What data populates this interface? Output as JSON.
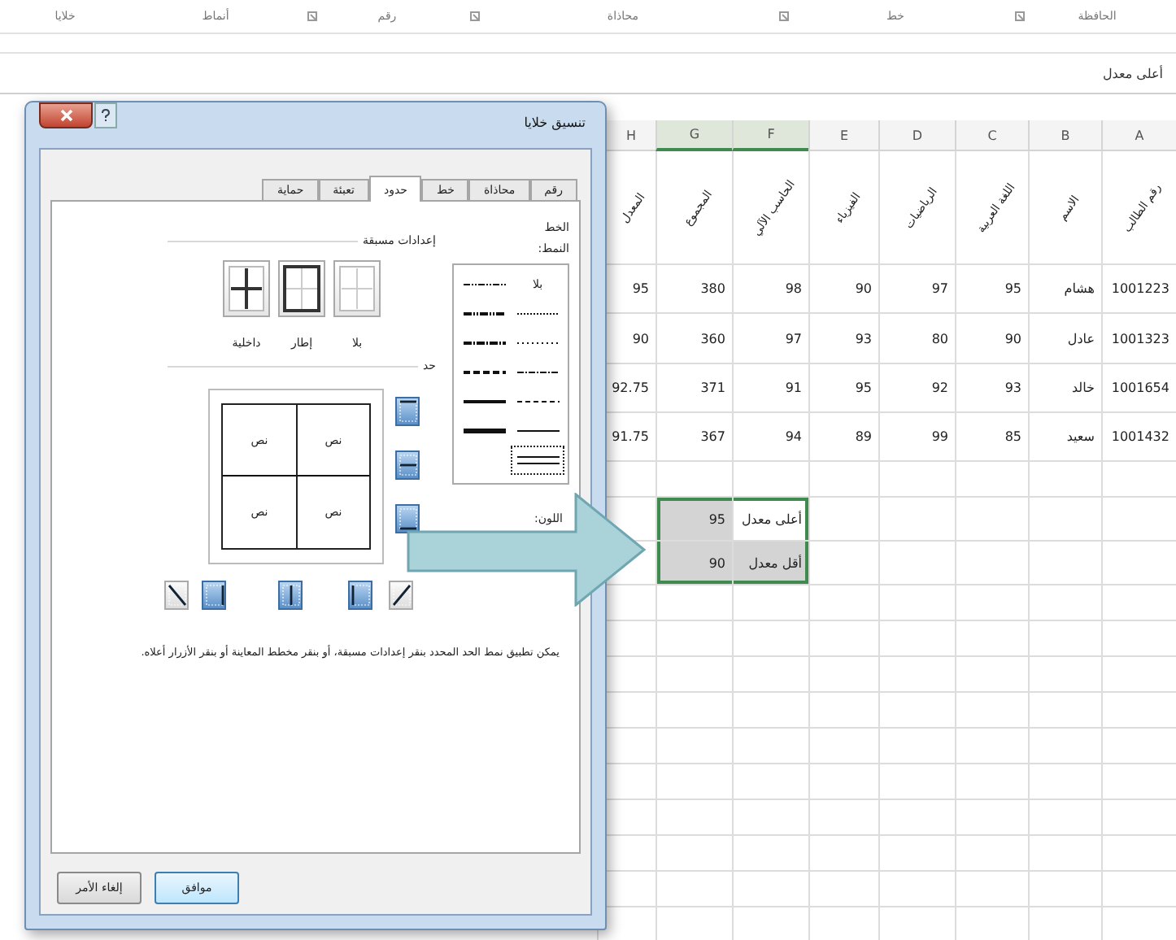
{
  "ribbon": {
    "groups": [
      {
        "label": "الحافظة",
        "launcher": true
      },
      {
        "label": "خط",
        "launcher": true
      },
      {
        "label": "محاذاة",
        "launcher": true
      },
      {
        "label": "رقم",
        "launcher": true
      },
      {
        "label": "أنماط",
        "launcher": false
      },
      {
        "label": "خلايا",
        "launcher": false
      }
    ]
  },
  "formula_bar": {
    "value": "أعلى معدل"
  },
  "sheet": {
    "columns": [
      {
        "label": "A",
        "selected": false
      },
      {
        "label": "B",
        "selected": false
      },
      {
        "label": "C",
        "selected": false
      },
      {
        "label": "D",
        "selected": false
      },
      {
        "label": "E",
        "selected": false
      },
      {
        "label": "F",
        "selected": true
      },
      {
        "label": "G",
        "selected": true
      },
      {
        "label": "H",
        "selected": false
      }
    ],
    "header_row": [
      "رقم الطالب",
      "الاسم",
      "اللغة العربية",
      "الرياضيات",
      "الفيزياء",
      "الحاسب الآلي",
      "المجموع",
      "المعدل"
    ],
    "rows": [
      [
        "1001223",
        "هشام",
        "95",
        "97",
        "90",
        "98",
        "380",
        "95"
      ],
      [
        "1001323",
        "عادل",
        "90",
        "80",
        "93",
        "97",
        "360",
        "90"
      ],
      [
        "1001654",
        "خالد",
        "93",
        "92",
        "95",
        "91",
        "371",
        "92.75"
      ],
      [
        "1001432",
        "سعيد",
        "85",
        "99",
        "89",
        "94",
        "367",
        "91.75"
      ]
    ],
    "summary": [
      {
        "label": "أعلى معدل",
        "value": "95",
        "active": true
      },
      {
        "label": "أقل معدل",
        "value": "90",
        "active": false
      }
    ]
  },
  "dialog": {
    "title": "تنسيق خلايا",
    "tabs": [
      {
        "label": "رقم",
        "selected": false
      },
      {
        "label": "محاذاة",
        "selected": false
      },
      {
        "label": "خط",
        "selected": false
      },
      {
        "label": "حدود",
        "selected": true
      },
      {
        "label": "تعبئة",
        "selected": false
      },
      {
        "label": "حماية",
        "selected": false
      }
    ],
    "line": {
      "heading": "الخط",
      "style_label": "النمط:",
      "color_label": "اللون:",
      "styles": [
        {
          "kind": "none",
          "label": "بلا",
          "selected": false
        },
        {
          "kind": "hair",
          "selected": false
        },
        {
          "kind": "dotted",
          "selected": false
        },
        {
          "kind": "dash-dot",
          "selected": false
        },
        {
          "kind": "dashed",
          "selected": false
        },
        {
          "kind": "thin",
          "selected": false
        },
        {
          "kind": "double",
          "selected": true
        },
        {
          "kind": "dash-dot-dot",
          "selected": false
        },
        {
          "kind": "medium-dash-dot-dot",
          "selected": false
        },
        {
          "kind": "medium-dash-dot",
          "selected": false
        },
        {
          "kind": "medium-dashed",
          "selected": false
        },
        {
          "kind": "medium",
          "selected": false
        },
        {
          "kind": "thick",
          "selected": false
        }
      ]
    },
    "presets": {
      "heading": "إعدادات مسبقة",
      "items": [
        {
          "kind": "none",
          "label": "بلا"
        },
        {
          "kind": "outline",
          "label": "إطار"
        },
        {
          "kind": "inside",
          "label": "داخلية"
        }
      ]
    },
    "border": {
      "heading": "حد",
      "cell_texts": [
        "نص",
        "نص",
        "نص",
        "نص"
      ],
      "buttons": [
        {
          "kind": "top",
          "on": true
        },
        {
          "kind": "inside-horizontal",
          "on": true
        },
        {
          "kind": "bottom",
          "on": true
        },
        {
          "kind": "diagonal-up",
          "on": false
        },
        {
          "kind": "left",
          "on": true
        },
        {
          "kind": "inside-vertical",
          "on": true
        },
        {
          "kind": "right",
          "on": true
        },
        {
          "kind": "diagonal-down",
          "on": false
        }
      ]
    },
    "hint": "يمكن تطبيق نمط الحد المحدد بنقر إعدادات مسبقة، أو بنقر مخطط المعاينة أو بنقر الأزرار أعلاه.",
    "buttons": [
      {
        "label": "موافق",
        "kind": "default"
      },
      {
        "label": "إلغاء الأمر",
        "kind": "normal"
      }
    ]
  }
}
